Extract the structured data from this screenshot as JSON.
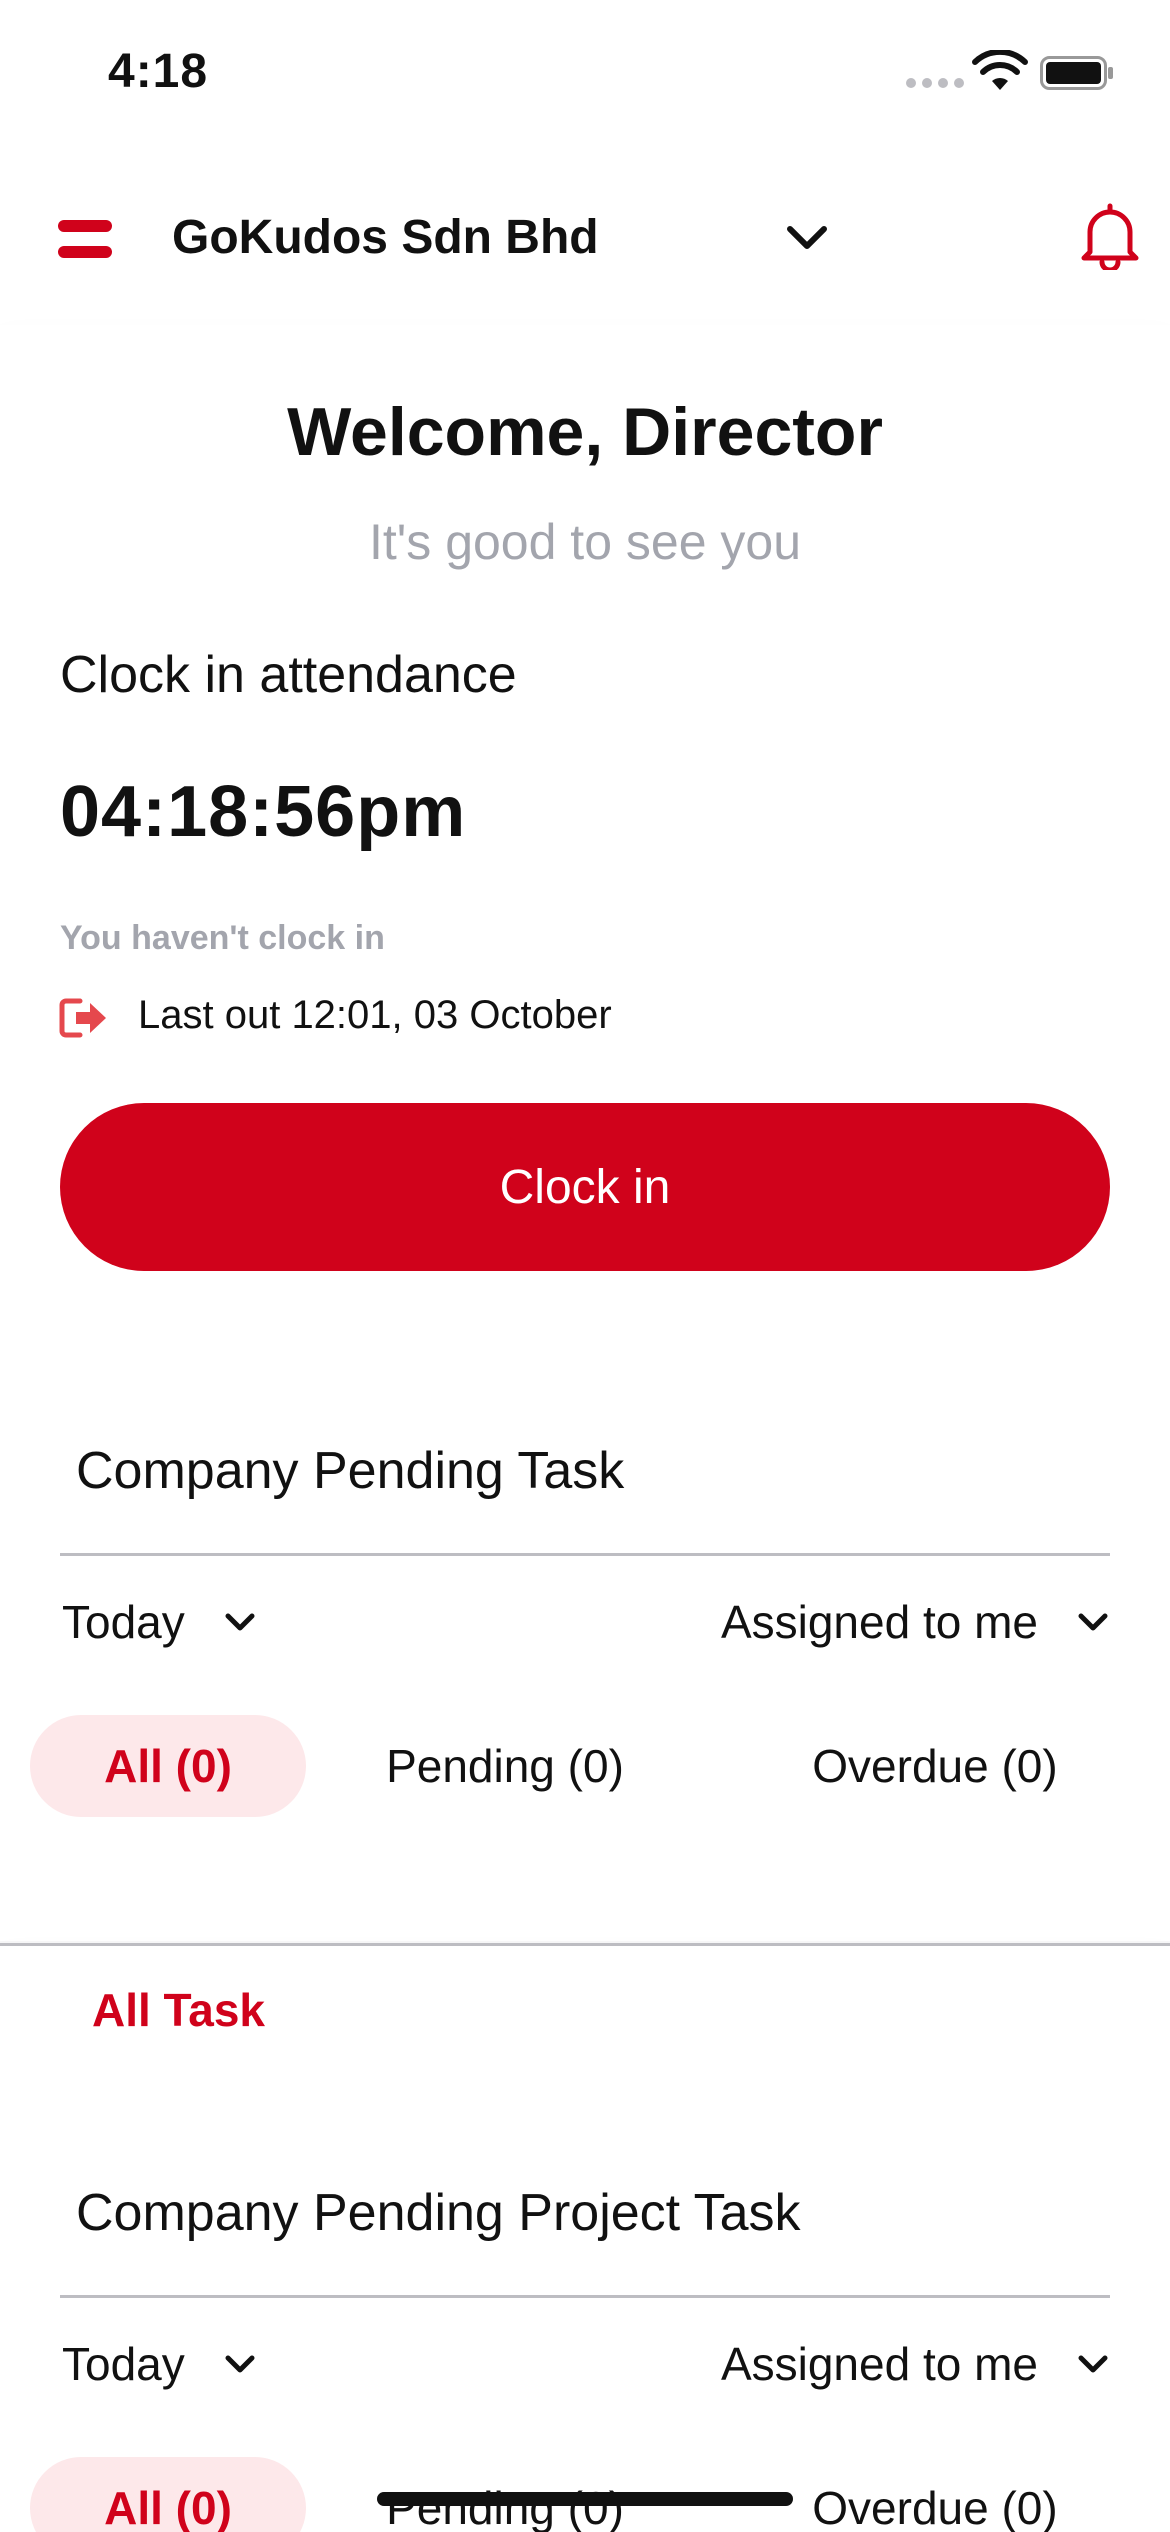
{
  "status_bar": {
    "time": "4:18"
  },
  "app_bar": {
    "company_name": "GoKudos Sdn Bhd"
  },
  "welcome": {
    "title": "Welcome, Director",
    "subtitle": "It's good to see you",
    "attendance_title": "Clock in attendance",
    "clock_time": "04:18:56pm",
    "status": "You haven't clock in",
    "last_out": "Last out 12:01, 03 October",
    "clock_in_label": "Clock in"
  },
  "pending_task": {
    "title": "Company Pending Task",
    "date_filter": "Today",
    "assignee_filter": "Assigned to me",
    "chips": {
      "all": "All (0)",
      "pending": "Pending (0)",
      "overdue": "Overdue (0)"
    },
    "all_task_link": "All Task"
  },
  "project_task": {
    "title": "Company Pending Project Task",
    "date_filter": "Today",
    "assignee_filter": "Assigned to me",
    "chips": {
      "all": "All (0)",
      "pending": "Pending (0)",
      "overdue": "Overdue (0)"
    }
  },
  "colors": {
    "accent": "#d0021b",
    "accent_soft": "#fde8ea",
    "muted_text": "#a3a5ad"
  }
}
